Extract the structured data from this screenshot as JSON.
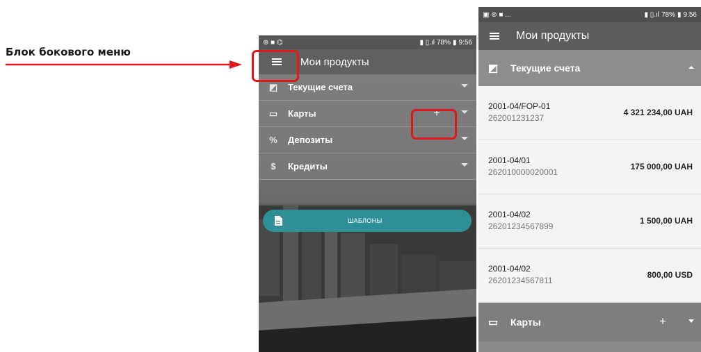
{
  "annotation": {
    "label": "Блок бокового меню",
    "accent": "#e0181b"
  },
  "status_bar_left": {
    "icons": "⊚ ■ ⌬",
    "clock": "9:56",
    "battery": "78%",
    "signal": "▮ ▯.ıl"
  },
  "status_bar_right": {
    "icons": "▣ ⊚ ■ ...",
    "clock": "9:56",
    "battery": "78%",
    "signal": "▮ ▯.ıl"
  },
  "app": {
    "title": "Мои продукты"
  },
  "side_menu": {
    "items": [
      {
        "label": "Текущие счета",
        "icon": "chart-icon"
      },
      {
        "label": "Карты",
        "icon": "card-icon",
        "action": "+"
      },
      {
        "label": "Депозиты",
        "icon": "percent-icon"
      },
      {
        "label": "Кредиты",
        "icon": "dollar-icon"
      }
    ],
    "templates_button": "ШАБЛОНЫ",
    "accent": "#2f8f96"
  },
  "accounts_screen": {
    "section_current": "Текущие счета",
    "accounts": [
      {
        "number": "2001-04/FOP-01",
        "iban": "262001231237",
        "amount": "4 321 234,00 UAH"
      },
      {
        "number": "2001-04/01",
        "iban": "262010000020001",
        "amount": "175 000,00 UAH"
      },
      {
        "number": "2001-04/02",
        "iban": "26201234567899",
        "amount": "1 500,00 UAH"
      },
      {
        "number": "2001-04/02",
        "iban": "26201234567811",
        "amount": "800,00 USD"
      }
    ],
    "section_cards": "Карты",
    "cards_action": "+"
  }
}
